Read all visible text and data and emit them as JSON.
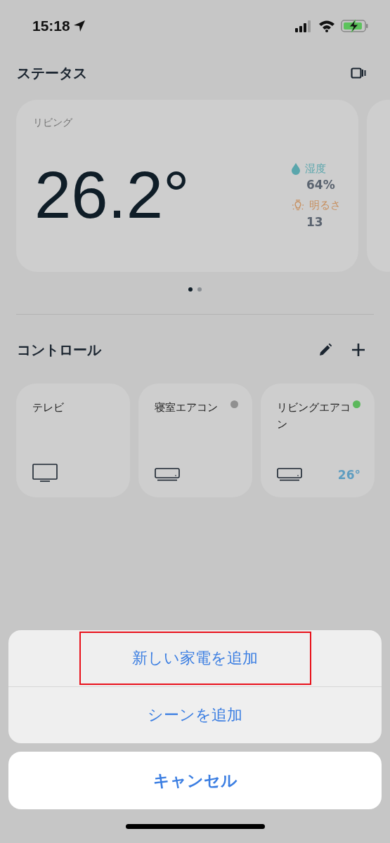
{
  "status_bar": {
    "time": "15:18"
  },
  "status_section": {
    "title": "ステータス",
    "cards": [
      {
        "room": "リビング",
        "temperature": "26.2°",
        "metrics": [
          {
            "kind": "humidity",
            "label": "湿度",
            "value": "64%"
          },
          {
            "kind": "brightness",
            "label": "明るさ",
            "value": "13"
          }
        ]
      }
    ],
    "pages": [
      {
        "selected": true
      },
      {
        "selected": false
      }
    ]
  },
  "control_section": {
    "title": "コントロール",
    "devices": [
      {
        "name": "テレビ",
        "kind": "tv"
      },
      {
        "name": "寝室エアコン",
        "kind": "ac",
        "color": "#909090"
      },
      {
        "name": "リビングエアコン",
        "kind": "ac",
        "color": "#5cb85c",
        "reading": "26°"
      }
    ]
  },
  "action_sheet": {
    "actions": [
      {
        "label": "新しい家電を追加",
        "highlighted": true
      },
      {
        "label": "シーンを追加",
        "highlighted": false
      }
    ],
    "cancel": "キャンセル"
  }
}
